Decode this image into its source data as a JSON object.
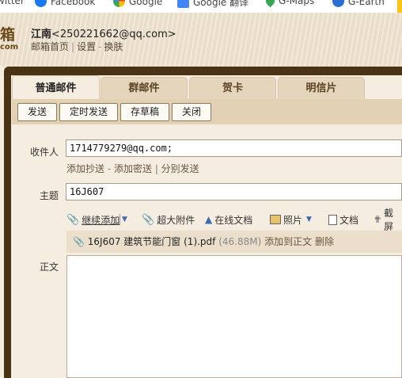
{
  "bookmarks": [
    {
      "label": "witter",
      "icon": "twitter-icon",
      "color": "#1da1f2"
    },
    {
      "label": "Facebook",
      "icon": "facebook-icon",
      "color": "#1877f2"
    },
    {
      "label": "Google",
      "icon": "google-icon",
      "color": "#34a853"
    },
    {
      "label": "Google 翻译",
      "icon": "google-translate-icon",
      "color": "#4285f4"
    },
    {
      "label": "G-Maps",
      "icon": "map-pin-icon",
      "color": "#34a853"
    },
    {
      "label": "G-Earth",
      "icon": "globe-icon",
      "color": "#2a6fd6"
    }
  ],
  "header": {
    "logo_top": "箱",
    "logo_bottom": "com",
    "user_name": "江南",
    "user_email": "<250221662@qq.com>",
    "link_home": "邮箱首页",
    "link_settings": "设置",
    "link_skin": "换肤"
  },
  "tabs": [
    {
      "label": "普通邮件",
      "active": true
    },
    {
      "label": "群邮件",
      "active": false
    },
    {
      "label": "贺卡",
      "active": false
    },
    {
      "label": "明信片",
      "active": false
    }
  ],
  "toolbar": {
    "send": "发送",
    "schedule": "定时发送",
    "save_draft": "存草稿",
    "close": "关闭"
  },
  "compose": {
    "to_label": "收件人",
    "to_value": "1714779279@qq.com;",
    "add_cc": "添加抄送",
    "add_bcc": "添加密送",
    "separate_send": "分别发送",
    "subject_label": "主题",
    "subject_value": "16J607",
    "body_label": "正文"
  },
  "attach_tools": {
    "continue_add": "继续添加",
    "large_attachment": "超大附件",
    "online_doc": "在线文档",
    "photo": "照片",
    "document": "文档",
    "screenshot": "截屏"
  },
  "attachment": {
    "filename": "16J607 建筑节能门窗 (1).pdf",
    "size": "(46.88M)",
    "add_to_body": "添加到正文",
    "delete": "删除"
  }
}
